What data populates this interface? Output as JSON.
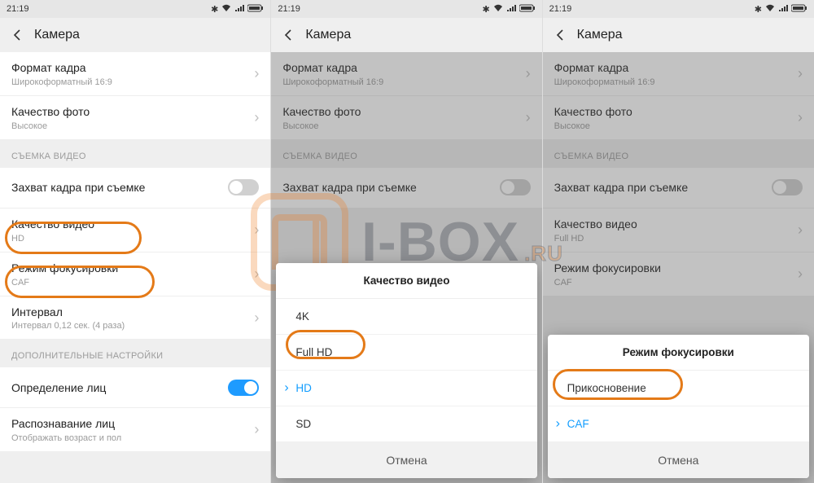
{
  "statusbar": {
    "time": "21:19"
  },
  "header": {
    "title": "Камера"
  },
  "rows": {
    "frame_format": {
      "title": "Формат кадра",
      "sub": "Широкоформатный 16:9"
    },
    "photo_quality": {
      "title": "Качество фото",
      "sub": "Высокое"
    },
    "capture_frame": {
      "title": "Захват кадра при съемке"
    },
    "video_quality": {
      "title": "Качество видео",
      "sub_hd": "HD",
      "sub_fullhd": "Full HD"
    },
    "focus_mode": {
      "title": "Режим фокусировки",
      "sub": "CAF"
    },
    "interval": {
      "title": "Интервал",
      "sub": "Интервал 0,12 сек. (4 раза)"
    },
    "face_detection": {
      "title": "Определение лиц"
    },
    "face_recognition": {
      "title": "Распознавание лиц",
      "sub": "Отображать возраст и пол"
    }
  },
  "sections": {
    "video": "СЪЕМКА ВИДЕО",
    "advanced": "ДОПОЛНИТЕЛЬНЫЕ НАСТРОЙКИ"
  },
  "dialog_quality": {
    "title": "Качество видео",
    "options": [
      "4K",
      "Full HD",
      "HD",
      "SD"
    ],
    "selected": "HD",
    "cancel": "Отмена"
  },
  "dialog_focus": {
    "title": "Режим фокусировки",
    "options": [
      "Прикосновение",
      "CAF"
    ],
    "selected": "CAF",
    "cancel": "Отмена"
  },
  "watermark": {
    "text_main": "I-BOX",
    "text_suffix": ".RU"
  }
}
